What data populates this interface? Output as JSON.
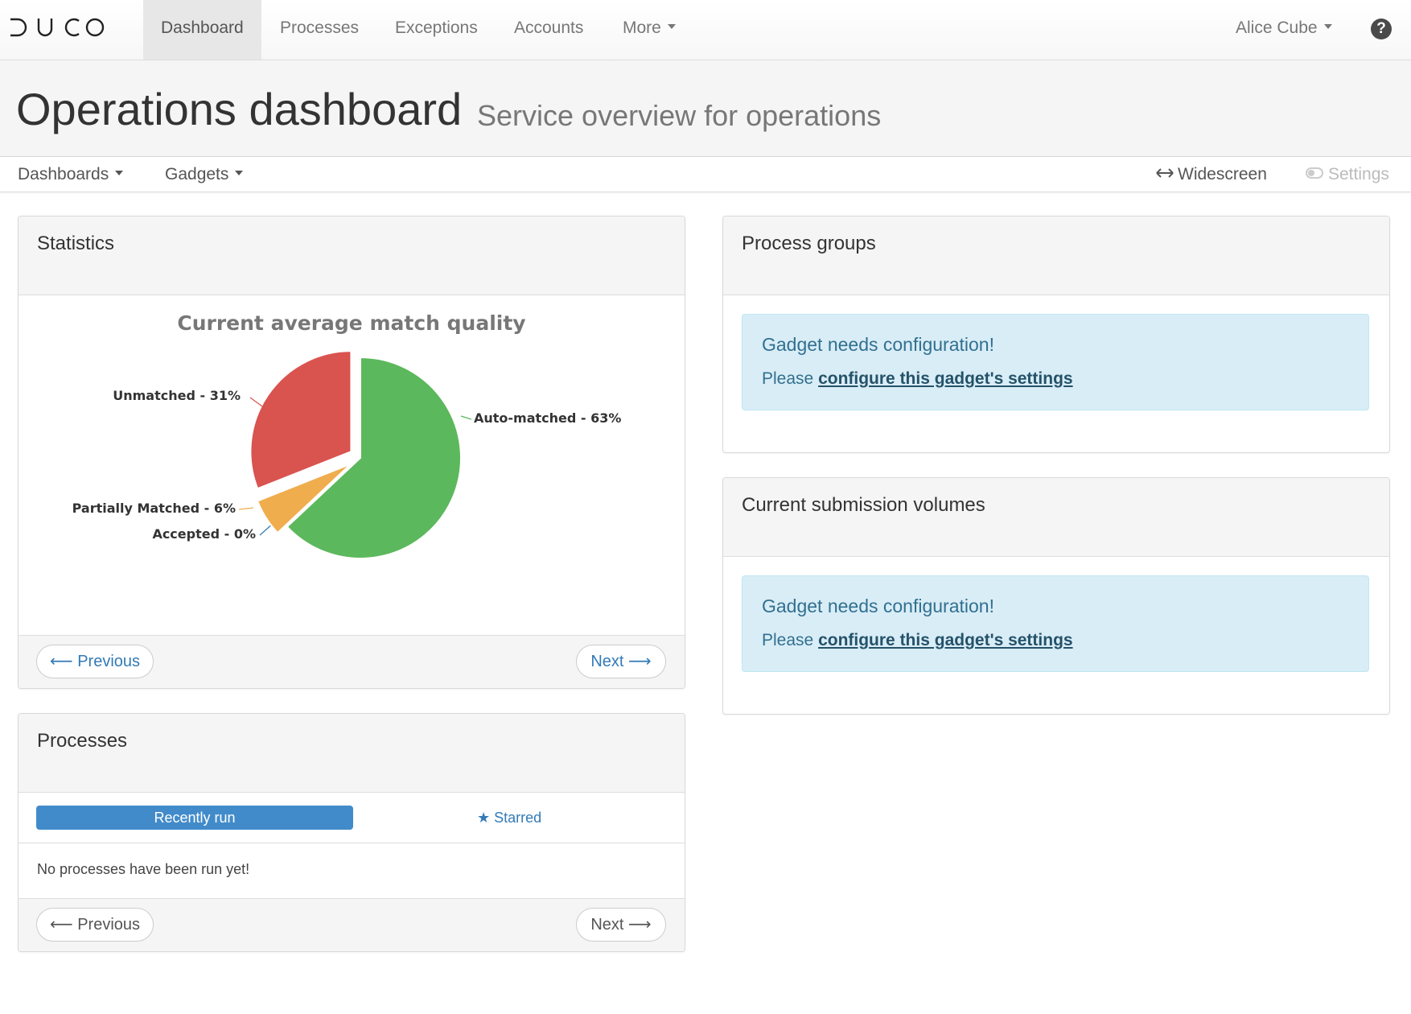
{
  "app": {
    "brand": "DUCO",
    "colors": {
      "accent": "#428bca",
      "link": "#337ab7",
      "alert_bg": "#d9edf7",
      "alert_text": "#31708f"
    }
  },
  "nav": {
    "items": [
      {
        "label": "Dashboard",
        "active": true
      },
      {
        "label": "Processes",
        "active": false
      },
      {
        "label": "Exceptions",
        "active": false
      },
      {
        "label": "Accounts",
        "active": false
      },
      {
        "label": "More",
        "active": false
      }
    ],
    "user": "Alice Cube",
    "help_icon": "question-circle-icon",
    "help_glyph": "?"
  },
  "header": {
    "title": "Operations dashboard",
    "subtitle": "Service overview for operations"
  },
  "subnav": {
    "dashboards": "Dashboards",
    "gadgets": "Gadgets",
    "widescreen": "Widescreen",
    "widescreen_icon": "horizontal-arrows-icon",
    "settings": "Settings",
    "settings_icon": "toggle-icon"
  },
  "statistics": {
    "title": "Statistics",
    "prev": "Previous",
    "next": "Next"
  },
  "chart_data": {
    "type": "pie",
    "title": "Current average match quality",
    "slices": [
      {
        "label": "Auto-matched",
        "value": 63,
        "display": "Auto-matched - 63%",
        "color": "#5cb85c"
      },
      {
        "label": "Accepted",
        "value": 0,
        "display": "Accepted - 0%",
        "color": "#337ab7"
      },
      {
        "label": "Partially Matched",
        "value": 6,
        "display": "Partially Matched - 6%",
        "color": "#f0ad4e"
      },
      {
        "label": "Unmatched",
        "value": 31,
        "display": "Unmatched - 31%",
        "color": "#d9534f"
      }
    ]
  },
  "processes": {
    "title": "Processes",
    "tab_recent": "Recently run",
    "tab_starred": "Starred",
    "empty": "No processes have been run yet!",
    "prev": "Previous",
    "next": "Next"
  },
  "process_groups": {
    "title": "Process groups",
    "alert_title": "Gadget needs configuration!",
    "alert_prefix": "Please",
    "alert_link": "configure this gadget's settings"
  },
  "submission_volumes": {
    "title": "Current submission volumes",
    "alert_title": "Gadget needs configuration!",
    "alert_prefix": "Please",
    "alert_link": "configure this gadget's settings"
  }
}
